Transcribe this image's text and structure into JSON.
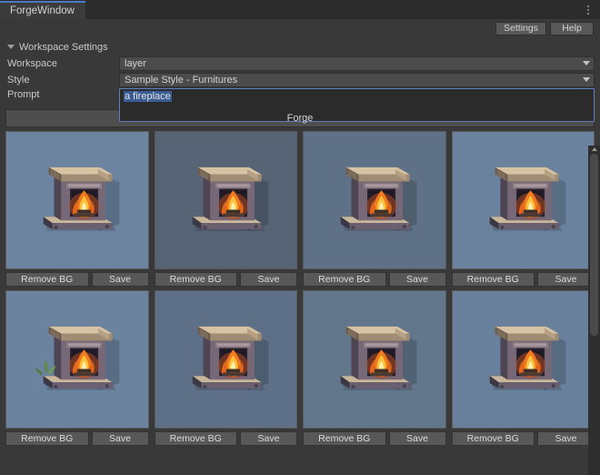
{
  "window": {
    "tab_label": "ForgeWindow",
    "kebab_icon": "kebab-menu-icon"
  },
  "toolbar": {
    "settings_label": "Settings",
    "help_label": "Help"
  },
  "settings": {
    "foldout_label": "Workspace Settings",
    "foldout_icon": "triangle-down-icon",
    "fields": [
      {
        "label": "Workspace",
        "value": "layer",
        "type": "dropdown",
        "arrow_icon": "chevron-down-icon"
      },
      {
        "label": "Style",
        "value": "Sample Style - Furnitures",
        "type": "dropdown",
        "arrow_icon": "chevron-down-icon"
      }
    ],
    "prompt": {
      "label": "Prompt",
      "value": "a fireplace",
      "selected": true
    }
  },
  "forge": {
    "button_label": "Forge"
  },
  "results": {
    "remove_bg_label": "Remove BG",
    "save_label": "Save",
    "rows": [
      [
        {
          "id": "result-1",
          "bg": "#6c84a0",
          "variant": "wide-mantel",
          "has_plant": false
        },
        {
          "id": "result-2",
          "bg": "#566476",
          "variant": "arched-dark",
          "has_plant": false
        },
        {
          "id": "result-3",
          "bg": "#5f7186",
          "variant": "tall-blaze",
          "has_plant": false
        },
        {
          "id": "result-4",
          "bg": "#6a829e",
          "variant": "stone-hearth",
          "has_plant": false
        }
      ],
      [
        {
          "id": "result-5",
          "bg": "#6b839f",
          "variant": "plant-hearth",
          "has_plant": true
        },
        {
          "id": "result-6",
          "bg": "#5d7087",
          "variant": "log-fire",
          "has_plant": false
        },
        {
          "id": "result-7",
          "bg": "#62768c",
          "variant": "boxy-hearth",
          "has_plant": false
        },
        {
          "id": "result-8",
          "bg": "#68809c",
          "variant": "slim-hearth",
          "has_plant": false
        }
      ]
    ]
  },
  "scrollbar": {
    "up_arrow_icon": "scroll-up-arrow-icon"
  },
  "colors": {
    "accent_tab": "#4a78c8",
    "selection": "#3a5c94",
    "panel_bg": "#393939",
    "field_bg": "#4b4b4b",
    "button_bg": "#585858"
  }
}
